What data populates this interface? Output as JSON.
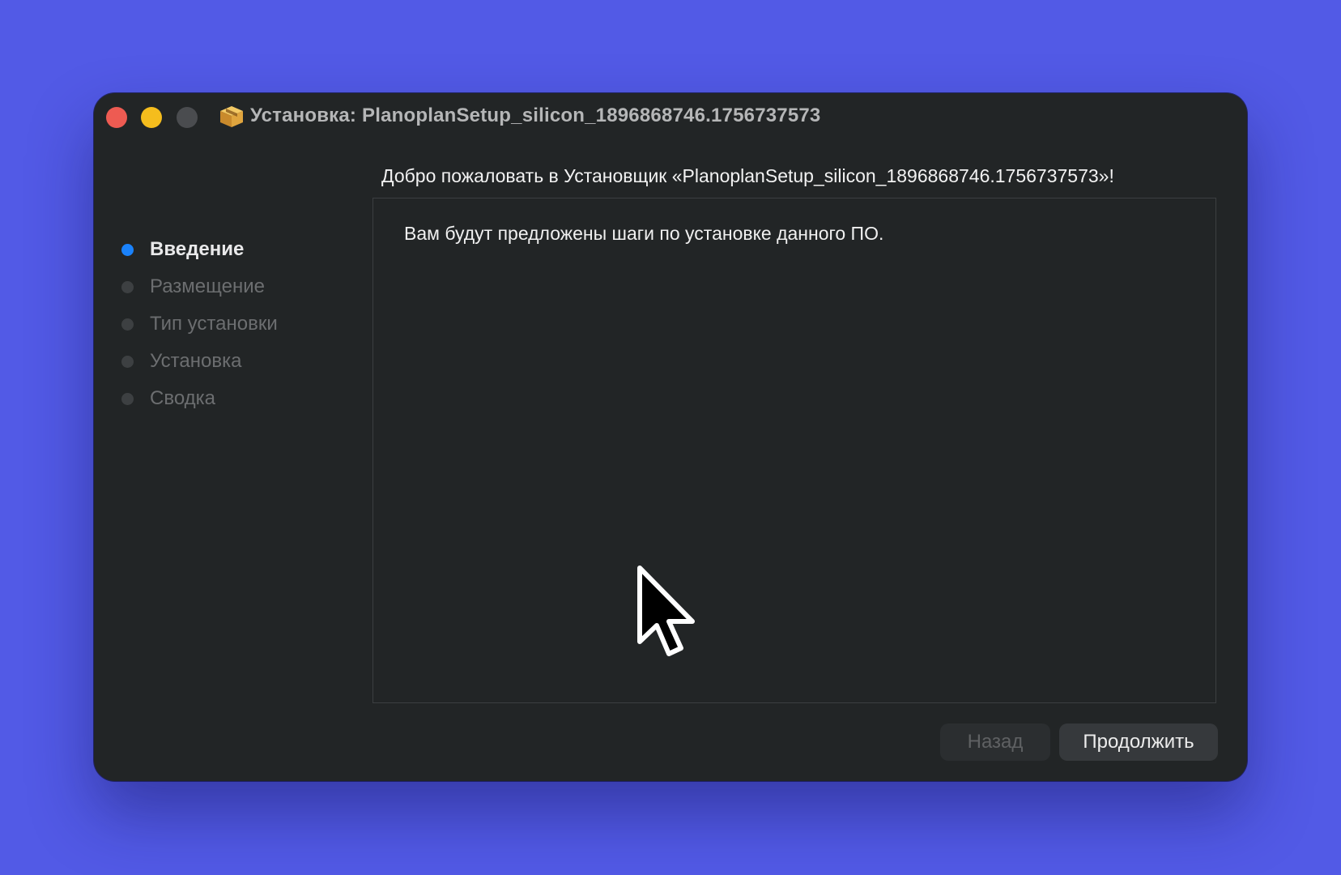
{
  "window": {
    "title": "Установка: PlanoplanSetup_silicon_1896868746.1756737573",
    "app_icon": "package-icon"
  },
  "welcome_heading": "Добро пожаловать в Установщик «PlanoplanSetup_silicon_1896868746.1756737573»!",
  "steps": [
    {
      "label": "Введение",
      "active": true
    },
    {
      "label": "Размещение",
      "active": false
    },
    {
      "label": "Тип установки",
      "active": false
    },
    {
      "label": "Установка",
      "active": false
    },
    {
      "label": "Сводка",
      "active": false
    }
  ],
  "content": {
    "intro_text": "Вам будут предложены шаги по установке данного ПО."
  },
  "buttons": {
    "back_label": "Назад",
    "continue_label": "Продолжить"
  },
  "colors": {
    "desktop_background": "#525ae6",
    "window_background": "#222526",
    "active_step_dot": "#1a82fb",
    "close_button": "#ee5b52",
    "minimize_button": "#f5bd1d"
  }
}
